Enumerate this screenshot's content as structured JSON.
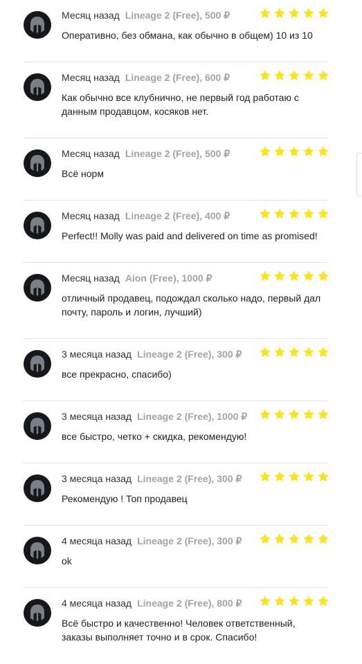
{
  "colors": {
    "star": "#fde31f",
    "avatar_bg": "#16171b",
    "avatar_helmet": "#7b7f88"
  },
  "reviews": [
    {
      "date": "Месяц назад",
      "game": "Lineage 2 (Free), 500 ₽",
      "rating": 5,
      "text": "Оперативно, без обмана, как обычно в общем) 10 из 10"
    },
    {
      "date": "Месяц назад",
      "game": "Lineage 2 (Free), 600 ₽",
      "rating": 5,
      "text": "Как обычно все клубнично, не первый год работаю с данным продавцом, косяков нет."
    },
    {
      "date": "Месяц назад",
      "game": "Lineage 2 (Free), 500 ₽",
      "rating": 5,
      "text": "Всё норм"
    },
    {
      "date": "Месяц назад",
      "game": "Lineage 2 (Free), 400 ₽",
      "rating": 5,
      "text": "Perfect!! Molly was paid and delivered on time as promised!"
    },
    {
      "date": "Месяц назад",
      "game": "Aion (Free), 1000 ₽",
      "rating": 5,
      "text": "отличный продавец, подождал сколько надо, первый дал почту, пароль и логин, лучший)"
    },
    {
      "date": "3 месяца назад",
      "game": "Lineage 2 (Free), 300 ₽",
      "rating": 5,
      "text": "все прекрасно, спасибо)"
    },
    {
      "date": "3 месяца назад",
      "game": "Lineage 2 (Free), 1000 ₽",
      "rating": 5,
      "text": "все быстро, четко + скидка, рекомендую!"
    },
    {
      "date": "3 месяца назад",
      "game": "Lineage 2 (Free), 300 ₽",
      "rating": 5,
      "text": "Рекомендую ! Топ продавец"
    },
    {
      "date": "4 месяца назад",
      "game": "Lineage 2 (Free), 300 ₽",
      "rating": 5,
      "text": "ok"
    },
    {
      "date": "4 месяца назад",
      "game": "Lineage 2 (Free), 800 ₽",
      "rating": 5,
      "text": "Всё быстро и качественно! Человек ответственный, заказы выполняет точно и в срок. Спасибо!"
    }
  ]
}
